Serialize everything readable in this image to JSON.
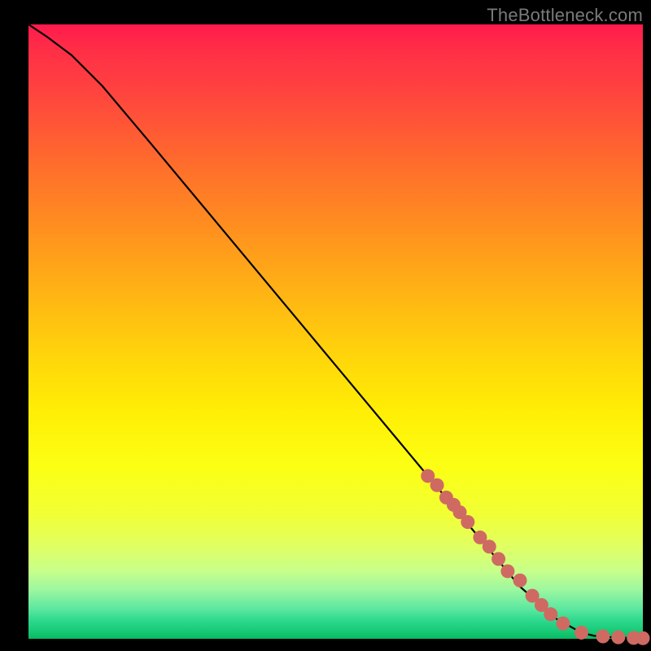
{
  "attribution": "TheBottleneck.com",
  "colors": {
    "point_fill": "#cf6a62",
    "curve_stroke": "#000000",
    "frame_bg": "#000000"
  },
  "chart_data": {
    "type": "line",
    "title": "",
    "xlabel": "",
    "ylabel": "",
    "xlim": [
      0,
      100
    ],
    "ylim": [
      0,
      100
    ],
    "grid": false,
    "legend": false,
    "series": [
      {
        "name": "curve",
        "x": [
          0,
          3,
          7,
          12,
          20,
          30,
          40,
          50,
          60,
          70,
          80,
          86,
          90,
          92,
          94,
          96,
          98,
          100
        ],
        "y": [
          100,
          98,
          95,
          90,
          80.5,
          68.5,
          56.5,
          44.5,
          32.5,
          20.5,
          8.5,
          3.2,
          1.0,
          0.5,
          0.3,
          0.2,
          0.15,
          0.1
        ]
      },
      {
        "name": "points",
        "x": [
          65,
          66.5,
          68,
          69.2,
          70.2,
          71.5,
          73.5,
          75,
          76.5,
          78,
          80,
          82,
          83.5,
          85,
          87,
          90,
          93.5,
          96,
          98.5,
          100
        ],
        "y": [
          26.5,
          25,
          23,
          21.8,
          20.6,
          19,
          16.5,
          15,
          13,
          11,
          9.5,
          7,
          5.5,
          4,
          2.5,
          1,
          0.4,
          0.25,
          0.15,
          0.1
        ]
      }
    ]
  }
}
